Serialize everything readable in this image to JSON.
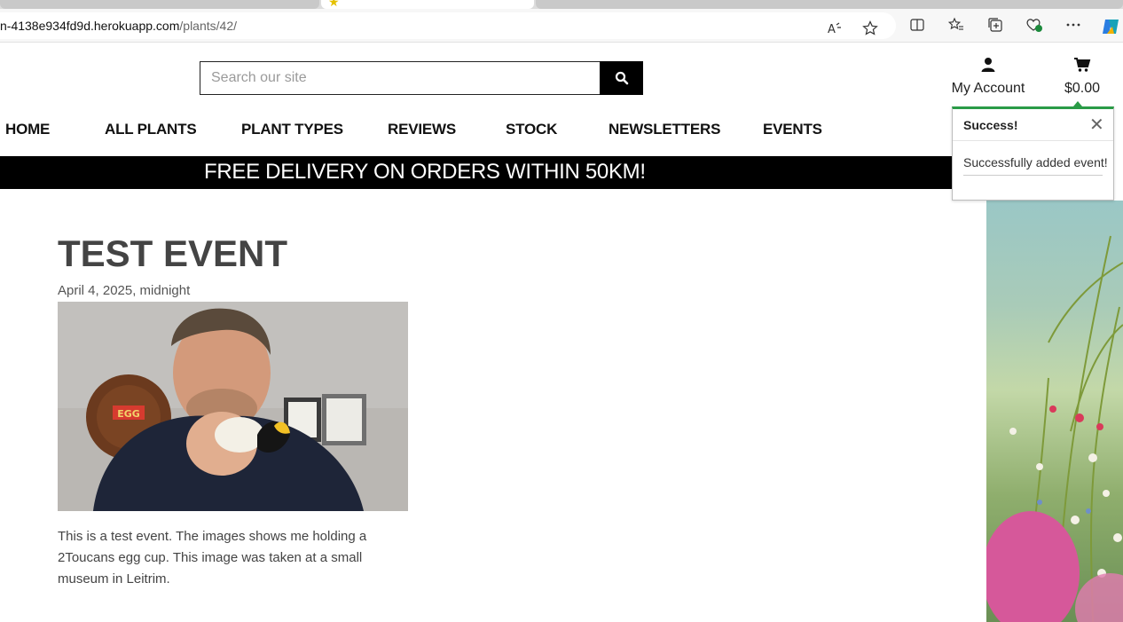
{
  "browser": {
    "url_host": "n-4138e934fd9d.herokuapp.com",
    "url_path": "/plants/42/"
  },
  "search": {
    "placeholder": "Search our site"
  },
  "account": {
    "label": "My Account"
  },
  "cart": {
    "total": "$0.00"
  },
  "nav": {
    "items": [
      {
        "label": "HOME"
      },
      {
        "label": "ALL PLANTS"
      },
      {
        "label": "PLANT TYPES"
      },
      {
        "label": "REVIEWS"
      },
      {
        "label": "STOCK"
      },
      {
        "label": "NEWSLETTERS"
      },
      {
        "label": "EVENTS"
      }
    ]
  },
  "banner": {
    "text": "FREE DELIVERY ON ORDERS WITHIN 50KM!"
  },
  "toast": {
    "title": "Success!",
    "message": "Successfully added event!",
    "accent": "#2a9b47"
  },
  "event": {
    "title": "TEST EVENT",
    "date": "April 4, 2025, midnight",
    "description": "This is a test event. The images shows me holding a 2Toucans egg cup. This image was taken at a small museum in Leitrim.",
    "photo_sign_text": "EGG"
  }
}
